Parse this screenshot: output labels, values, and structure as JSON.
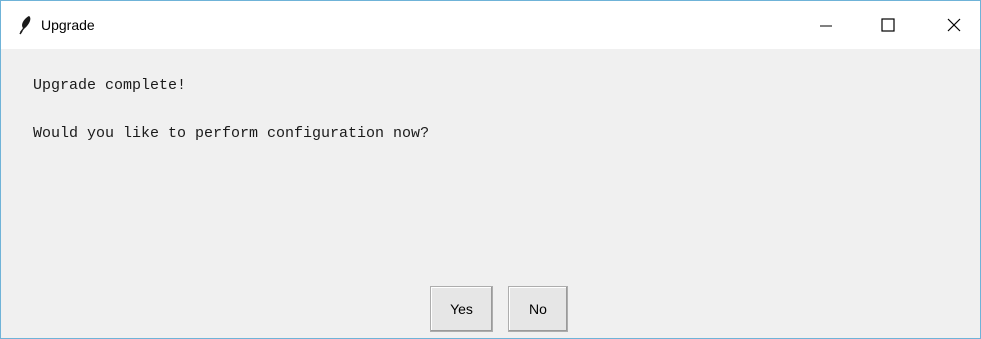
{
  "window": {
    "title": "Upgrade",
    "app_icon": "feather-icon",
    "controls": {
      "minimize": "minimize-icon",
      "maximize": "maximize-icon",
      "close": "close-icon"
    }
  },
  "dialog": {
    "message_line1": "Upgrade complete!",
    "message_line2": "Would you like to perform configuration now?",
    "yes_label": "Yes",
    "no_label": "No"
  },
  "colors": {
    "titlebar": "#ffffff",
    "body": "#f0f0f0",
    "border": "#6fb3d8"
  }
}
